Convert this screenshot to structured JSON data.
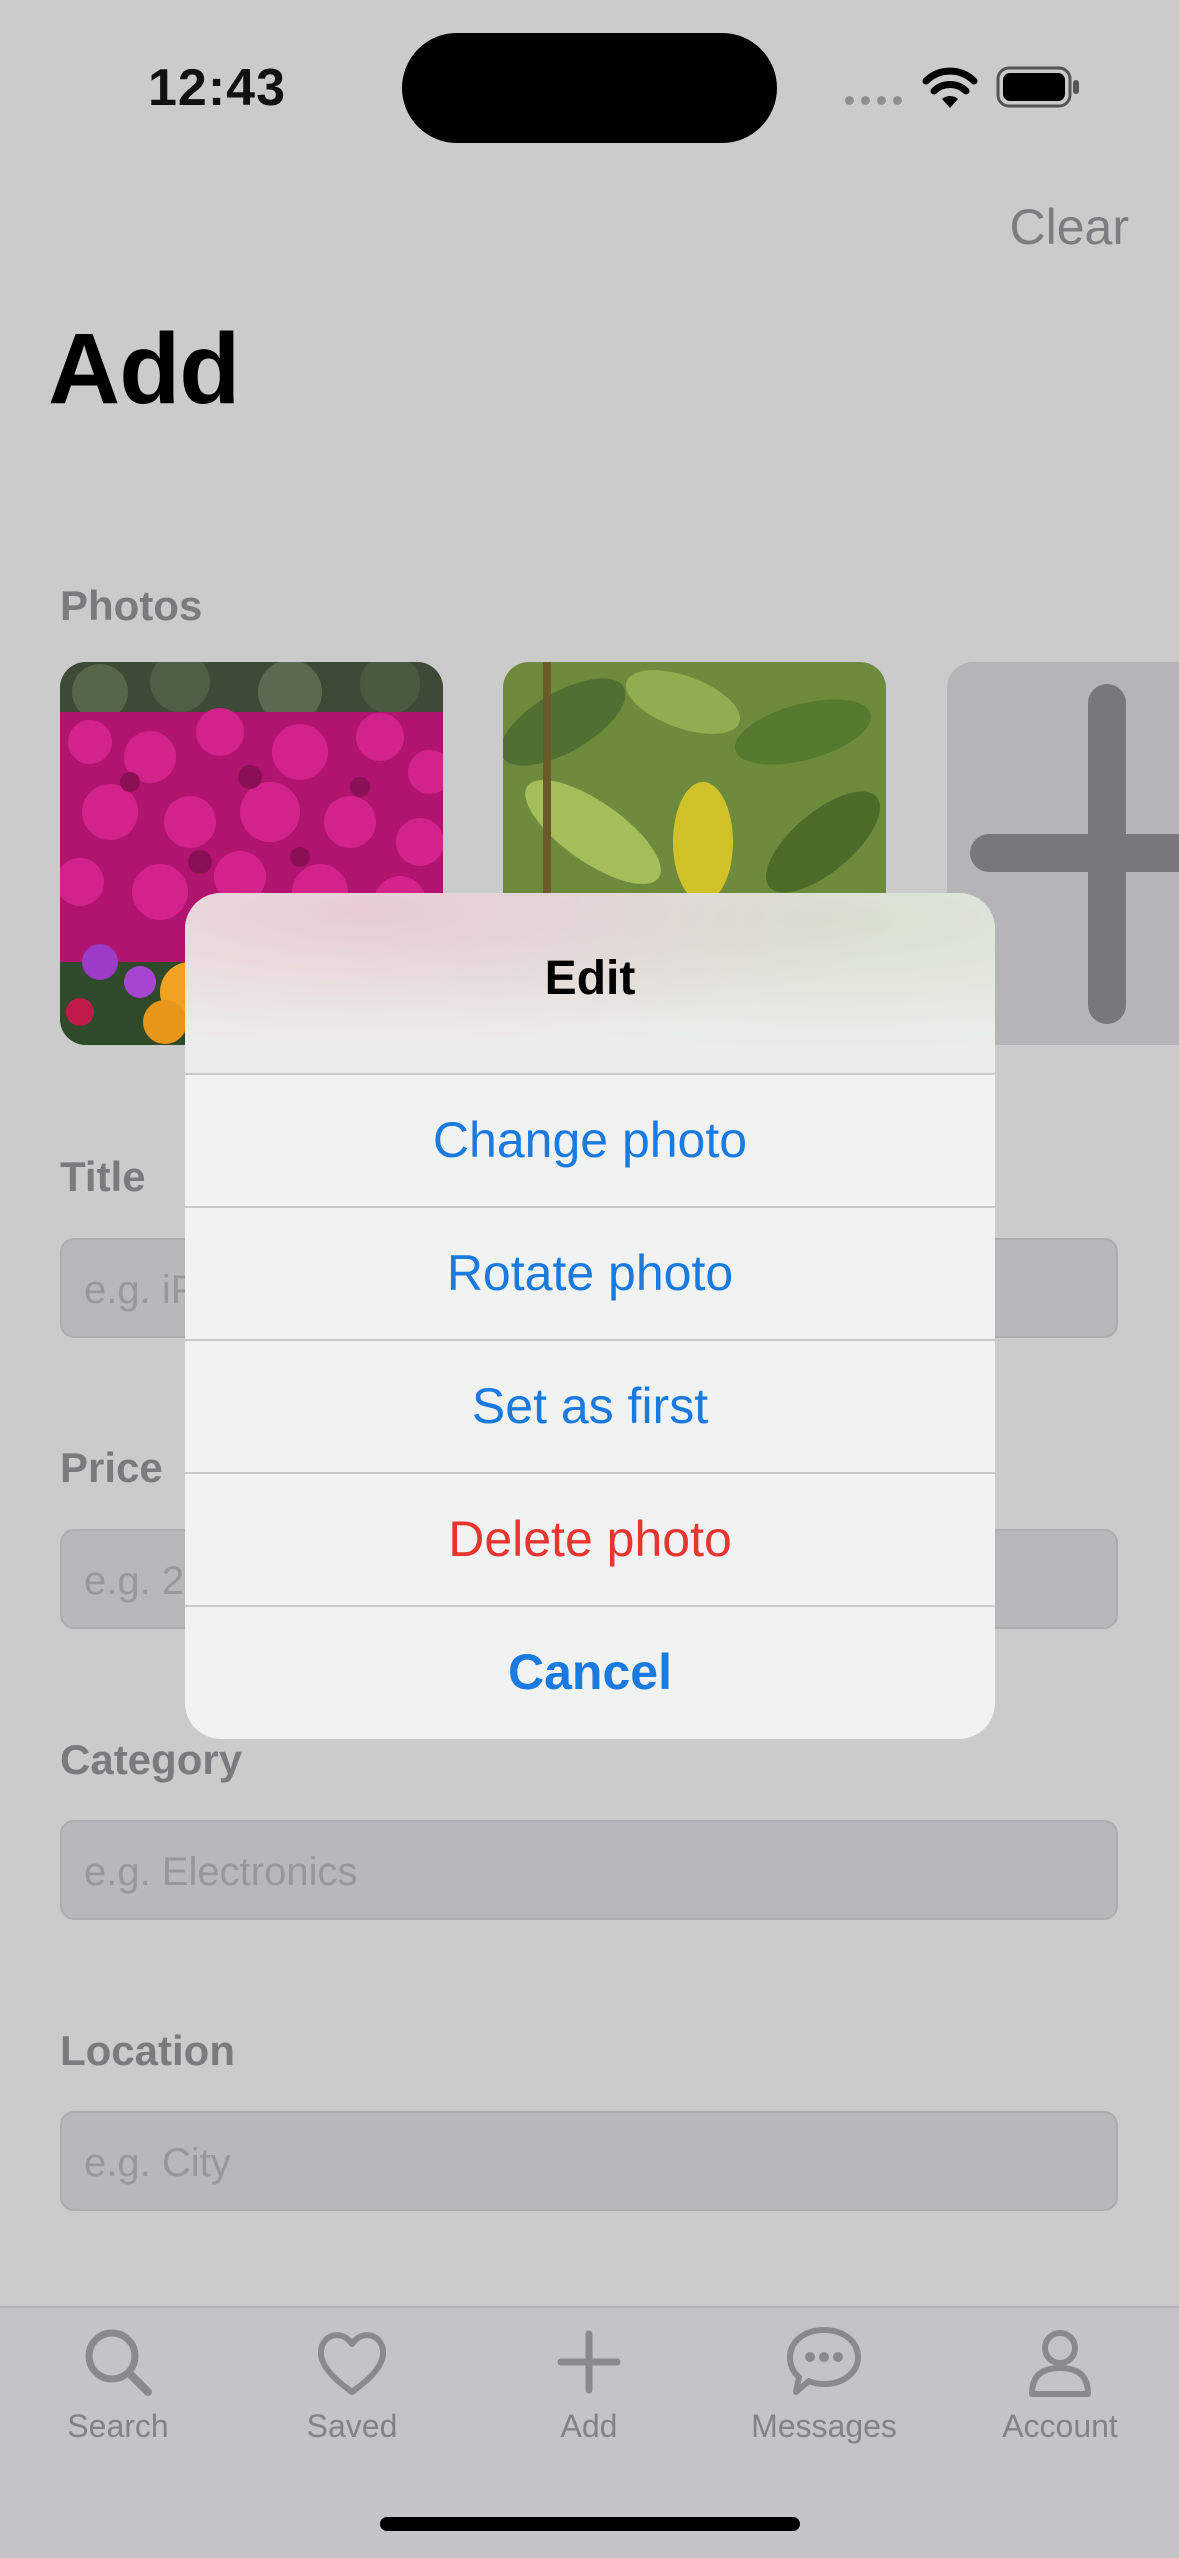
{
  "status_bar": {
    "time": "12:43"
  },
  "header": {
    "clear_label": "Clear",
    "title": "Add"
  },
  "photos": {
    "label": "Photos"
  },
  "fields": [
    {
      "label": "Title",
      "placeholder": "e.g. iPhone"
    },
    {
      "label": "Price",
      "placeholder": "e.g. 250"
    },
    {
      "label": "Category",
      "placeholder": "e.g. Electronics"
    },
    {
      "label": "Location",
      "placeholder": "e.g. City"
    }
  ],
  "dialog": {
    "title": "Edit",
    "actions": [
      {
        "label": "Change photo",
        "style": "default"
      },
      {
        "label": "Rotate photo",
        "style": "default"
      },
      {
        "label": "Set as first",
        "style": "default"
      },
      {
        "label": "Delete photo",
        "style": "destructive"
      },
      {
        "label": "Cancel",
        "style": "cancel"
      }
    ]
  },
  "tab_bar": [
    {
      "label": "Search",
      "icon": "search-icon"
    },
    {
      "label": "Saved",
      "icon": "heart-icon"
    },
    {
      "label": "Add",
      "icon": "plus-icon"
    },
    {
      "label": "Messages",
      "icon": "chat-bubble-icon"
    },
    {
      "label": "Account",
      "icon": "person-icon"
    }
  ],
  "colors": {
    "accent": "#1a7ae0",
    "destructive": "#e8352f"
  }
}
